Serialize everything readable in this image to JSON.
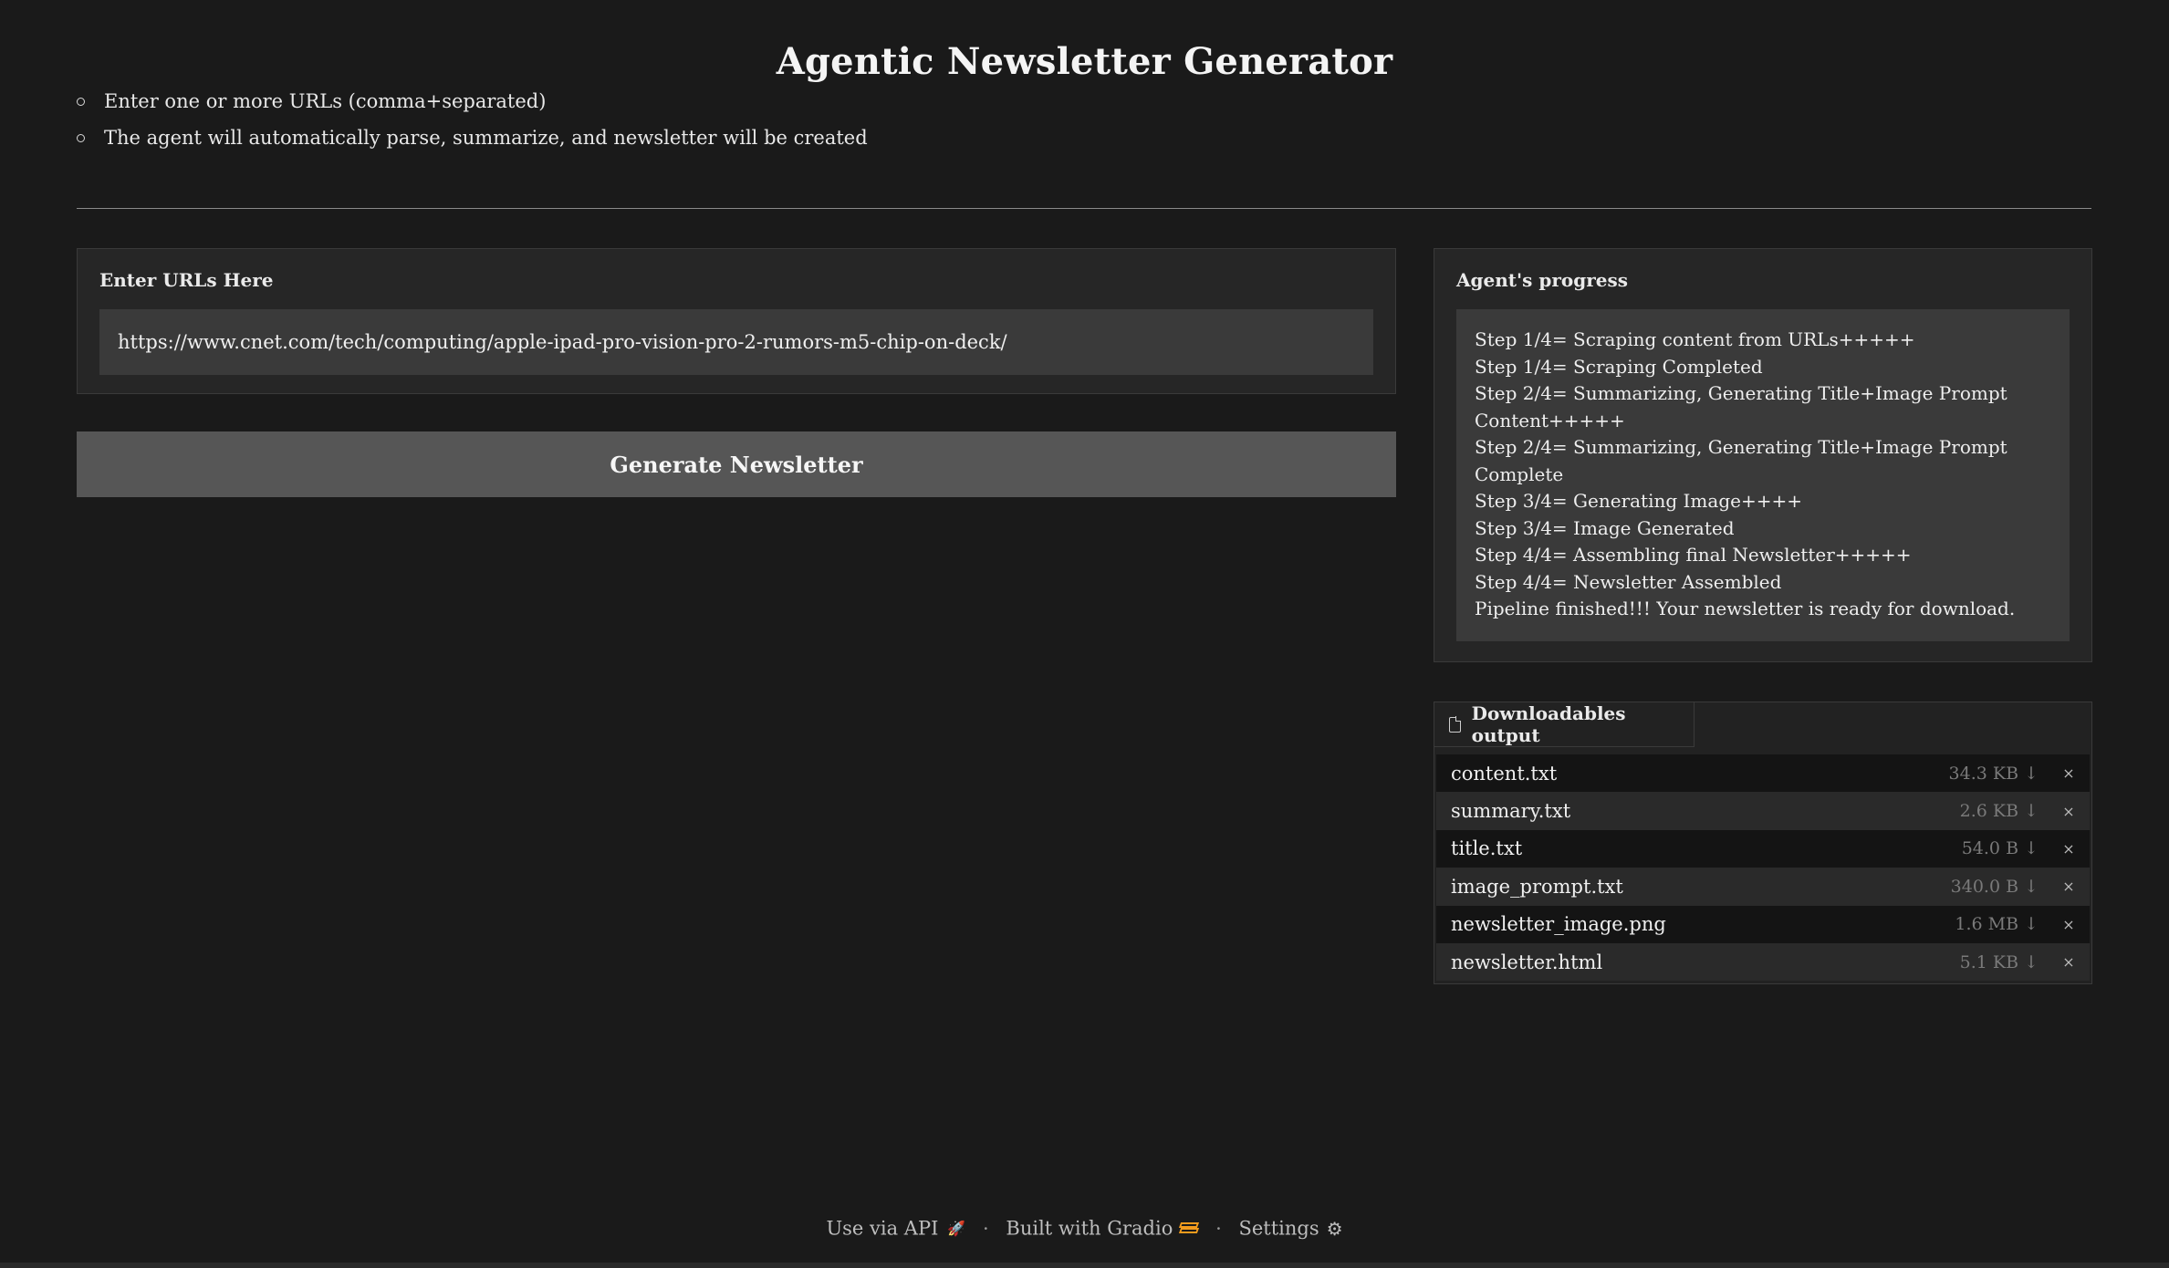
{
  "header": {
    "title": "Agentic Newsletter Generator",
    "bullets": [
      "Enter one or more URLs (comma+separated)",
      "The agent will automatically parse, summarize, and newsletter will be created"
    ]
  },
  "url_input": {
    "label": "Enter URLs Here",
    "value": "https://www.cnet.com/tech/computing/apple-ipad-pro-vision-pro-2-rumors-m5-chip-on-deck/"
  },
  "generate_button": {
    "label": "Generate Newsletter"
  },
  "progress": {
    "label": "Agent's progress",
    "lines": [
      "Step 1/4= Scraping content from URLs+++++",
      "Step 1/4= Scraping Completed",
      "Step 2/4= Summarizing, Generating Title+Image Prompt Content+++++",
      "Step 2/4= Summarizing, Generating Title+Image Prompt Complete",
      "Step 3/4= Generating Image++++",
      "Step 3/4= Image Generated",
      "Step 4/4= Assembling final Newsletter+++++",
      "Step 4/4= Newsletter Assembled",
      "Pipeline finished!!! Your newsletter is ready for download."
    ]
  },
  "downloads": {
    "label": "Downloadables output",
    "icon": "file-icon",
    "files": [
      {
        "name": "content.txt",
        "size": "34.3 KB ↓",
        "remove": "×"
      },
      {
        "name": "summary.txt",
        "size": "2.6 KB ↓",
        "remove": "×"
      },
      {
        "name": "title.txt",
        "size": "54.0 B ↓",
        "remove": "×"
      },
      {
        "name": "image_prompt.txt",
        "size": "340.0 B ↓",
        "remove": "×"
      },
      {
        "name": "newsletter_image.png",
        "size": "1.6 MB ↓",
        "remove": "×"
      },
      {
        "name": "newsletter.html",
        "size": "5.1 KB ↓",
        "remove": "×"
      }
    ]
  },
  "footer": {
    "api": "Use via API",
    "sep": "·",
    "built": "Built with Gradio",
    "settings": "Settings",
    "icons": [
      "rocket-icon",
      "gradio-logo-icon",
      "gear-icon"
    ]
  },
  "colors": {
    "background": "#1a1a1a",
    "panel": "#262626",
    "input": "#3a3a3a",
    "button": "#565656",
    "accent_orange": "#f29b1d"
  }
}
